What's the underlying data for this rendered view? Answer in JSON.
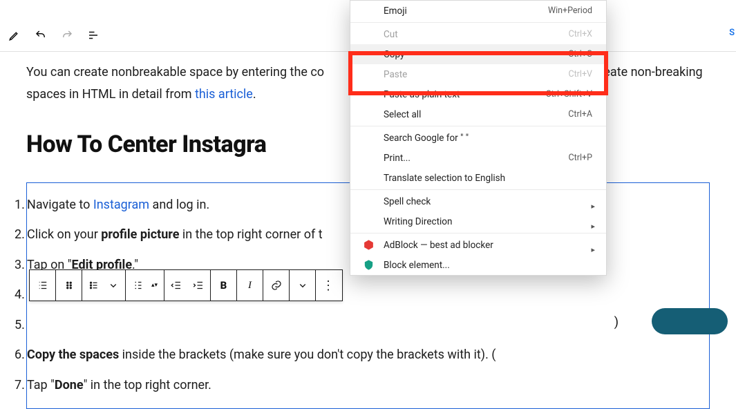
{
  "paragraph": {
    "pre": "You can create nonbreakable space by entering the co",
    "post_right": "create non-breaking",
    "line2_a": "spaces in HTML in detail from ",
    "link": "this article",
    "line2_b": "."
  },
  "heading": "How To Center Instagra",
  "steps": [
    {
      "pre": "Navigate to ",
      "link": "Instagram",
      "post": " and log in."
    },
    {
      "pre": "Click on your ",
      "bold": "profile picture",
      "post": " in the top right corner of t"
    },
    {
      "pre": "Tap on \"",
      "bold": "Edit profile",
      "post": ".\""
    },
    {
      "pre": "",
      "bold": "",
      "post": ""
    },
    {
      "pre": "",
      "bold": "",
      "post": ""
    },
    {
      "pre": "",
      "bold": "Copy the spaces",
      "post": " inside the brackets (make sure you don't copy the brackets with it). ("
    },
    {
      "pre": "Tap \"",
      "bold": "Done",
      "post": "\" in the top right corner."
    }
  ],
  "context_menu": {
    "emoji": "Emoji",
    "emoji_kb": "Win+Period",
    "cut": "Cut",
    "cut_kb": "Ctrl+X",
    "copy": "Copy",
    "copy_kb": "Ctrl+C",
    "paste": "Paste",
    "paste_kb": "Ctrl+V",
    "paste_plain": "Paste as plain text",
    "paste_plain_kb": "Ctrl+Shift+V",
    "select_all": "Select all",
    "select_all_kb": "Ctrl+A",
    "search": "Search Google for \"                          \"",
    "print": "Print...",
    "print_kb": "Ctrl+P",
    "translate": "Translate selection to English",
    "spell": "Spell check",
    "writing": "Writing Direction",
    "adblock": "AdBlock — best ad blocker",
    "blockel": "Block element..."
  },
  "block_toolbar": {
    "bold": "B",
    "italic": "I"
  },
  "misc": {
    "s_mark": "S",
    "close_paren": ")"
  }
}
